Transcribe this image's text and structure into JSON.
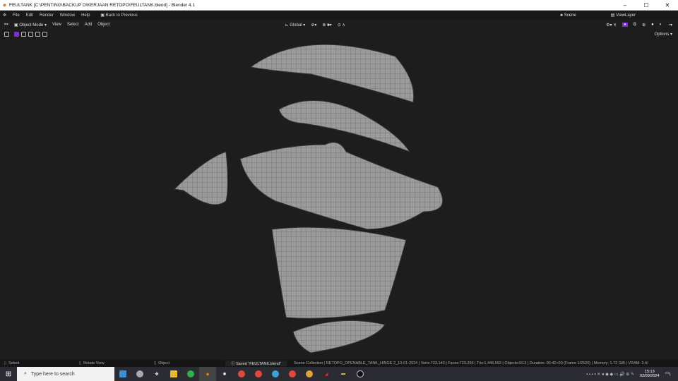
{
  "window": {
    "title": "FEULTANK [C:\\PENTING\\BACKUP D\\KERJAAN RETOPO\\FEULTANK.blend] - Blender 4.1"
  },
  "menu": {
    "items": [
      "File",
      "Edit",
      "Render",
      "Window",
      "Help"
    ],
    "back": "Back to Previous",
    "scene": "Scene",
    "view_layer": "ViewLayer"
  },
  "header": {
    "mode": "Object Mode",
    "items": [
      "View",
      "Select",
      "Add",
      "Object"
    ],
    "orientation": "Global",
    "options": "Options"
  },
  "accent": "#7b2fd6",
  "status": {
    "left": "Select",
    "middle": "Rotate View",
    "right": "Object",
    "saved": "Saved \"FEULTANK.blend\"",
    "info": "Scene Collection | RETOPO_OPENABLE_TANK_HINGE 2_13-01-2024 | Verts:723,140 | Faces:723,296 | Tris:1,446,592 | Objects:0/13 | Duration: 00:42+00 (Frame 1/2520) | Memory: 1.72 GiB | VRAM: 3.4/"
  },
  "taskbar": {
    "search_placeholder": "Type here to search",
    "time": "15:13",
    "date": "02/09/2024",
    "notif_count": "1",
    "apps": [
      "task-view",
      "security",
      "fan-app",
      "file-explorer",
      "whatsapp",
      "blender",
      "chatgpt",
      "chrome",
      "chrome",
      "chrome",
      "chrome",
      "chrome",
      "msi-app",
      "app",
      "obs"
    ]
  }
}
